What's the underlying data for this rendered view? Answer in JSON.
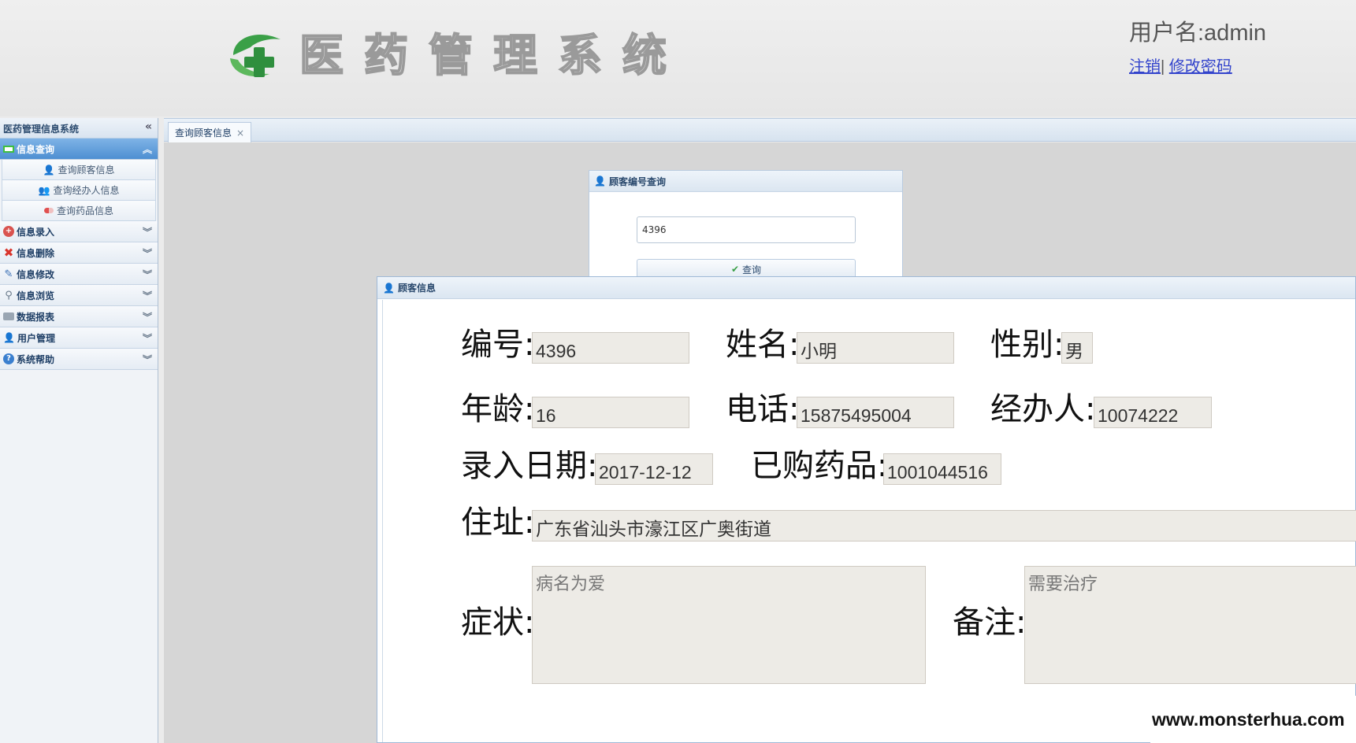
{
  "header": {
    "title_chars": [
      "医",
      "药",
      "管",
      "理",
      "系",
      "统"
    ],
    "username": "用户名:admin",
    "logout_label": "注销",
    "separator": "|",
    "change_password_label": "修改密码"
  },
  "sidebar": {
    "title": "医药管理信息系统",
    "groups": [
      {
        "label": "信息查询",
        "icon": "window-icon",
        "expanded": true,
        "items": [
          {
            "label": "查询顾客信息",
            "icon": "user-icon"
          },
          {
            "label": "查询经办人信息",
            "icon": "users-icon"
          },
          {
            "label": "查询药品信息",
            "icon": "pill-icon"
          }
        ]
      },
      {
        "label": "信息录入",
        "icon": "add-circle-icon"
      },
      {
        "label": "信息删除",
        "icon": "delete-x-icon"
      },
      {
        "label": "信息修改",
        "icon": "pencil-icon"
      },
      {
        "label": "信息浏览",
        "icon": "magnifier-icon"
      },
      {
        "label": "数据报表",
        "icon": "printer-icon"
      },
      {
        "label": "用户管理",
        "icon": "user-manage-icon"
      },
      {
        "label": "系统帮助",
        "icon": "help-icon"
      }
    ]
  },
  "tabs": [
    {
      "label": "查询顾客信息",
      "close": "×"
    }
  ],
  "query_panel": {
    "title": "顾客编号查询",
    "input_value": "4396",
    "button_label": "查询"
  },
  "customer_dialog": {
    "title": "顾客信息",
    "fields": {
      "id": {
        "label": "编号:",
        "value": "4396"
      },
      "name": {
        "label": "姓名:",
        "value": "小明"
      },
      "gender": {
        "label": "性别:",
        "value": "男"
      },
      "age": {
        "label": "年龄:",
        "value": "16"
      },
      "phone": {
        "label": "电话:",
        "value": "15875495004"
      },
      "agent": {
        "label": "经办人:",
        "value": "10074222"
      },
      "entry_date": {
        "label": "录入日期:",
        "value": "2017-12-12"
      },
      "purchased_drug": {
        "label": "已购药品:",
        "value": "1001044516"
      },
      "address": {
        "label": "住址:",
        "value": "广东省汕头市濠江区广奥街道"
      },
      "symptom": {
        "label": "症状:",
        "value": "病名为爱"
      },
      "remark": {
        "label": "备注:",
        "value": "需要治疗"
      }
    }
  },
  "watermark": "www.monsterhua.com",
  "colors": {
    "accent": "#4d8fd2",
    "link": "#3344cc",
    "field_bg": "#edebe6"
  }
}
